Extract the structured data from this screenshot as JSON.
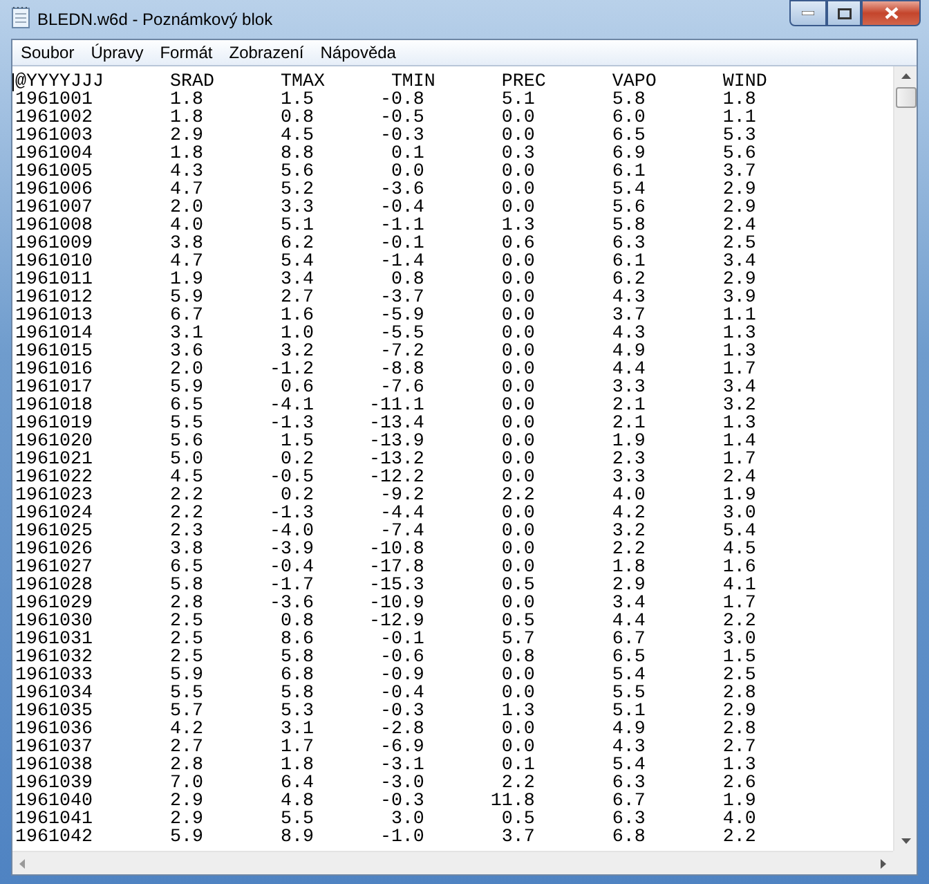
{
  "window": {
    "title": "BLEDN.w6d - Poznámkový blok"
  },
  "menu": [
    "Soubor",
    "Úpravy",
    "Formát",
    "Zobrazení",
    "Nápověda"
  ],
  "document": {
    "columns": [
      "@YYYYJJJ",
      "SRAD",
      "TMAX",
      "TMIN",
      "PREC",
      "VAPO",
      "WIND"
    ],
    "rows": [
      [
        "1961001",
        "1.8",
        "1.5",
        "-0.8",
        "5.1",
        "5.8",
        "1.8"
      ],
      [
        "1961002",
        "1.8",
        "0.8",
        "-0.5",
        "0.0",
        "6.0",
        "1.1"
      ],
      [
        "1961003",
        "2.9",
        "4.5",
        "-0.3",
        "0.0",
        "6.5",
        "5.3"
      ],
      [
        "1961004",
        "1.8",
        "8.8",
        "0.1",
        "0.3",
        "6.9",
        "5.6"
      ],
      [
        "1961005",
        "4.3",
        "5.6",
        "0.0",
        "0.0",
        "6.1",
        "3.7"
      ],
      [
        "1961006",
        "4.7",
        "5.2",
        "-3.6",
        "0.0",
        "5.4",
        "2.9"
      ],
      [
        "1961007",
        "2.0",
        "3.3",
        "-0.4",
        "0.0",
        "5.6",
        "2.9"
      ],
      [
        "1961008",
        "4.0",
        "5.1",
        "-1.1",
        "1.3",
        "5.8",
        "2.4"
      ],
      [
        "1961009",
        "3.8",
        "6.2",
        "-0.1",
        "0.6",
        "6.3",
        "2.5"
      ],
      [
        "1961010",
        "4.7",
        "5.4",
        "-1.4",
        "0.0",
        "6.1",
        "3.4"
      ],
      [
        "1961011",
        "1.9",
        "3.4",
        "0.8",
        "0.0",
        "6.2",
        "2.9"
      ],
      [
        "1961012",
        "5.9",
        "2.7",
        "-3.7",
        "0.0",
        "4.3",
        "3.9"
      ],
      [
        "1961013",
        "6.7",
        "1.6",
        "-5.9",
        "0.0",
        "3.7",
        "1.1"
      ],
      [
        "1961014",
        "3.1",
        "1.0",
        "-5.5",
        "0.0",
        "4.3",
        "1.3"
      ],
      [
        "1961015",
        "3.6",
        "3.2",
        "-7.2",
        "0.0",
        "4.9",
        "1.3"
      ],
      [
        "1961016",
        "2.0",
        "-1.2",
        "-8.8",
        "0.0",
        "4.4",
        "1.7"
      ],
      [
        "1961017",
        "5.9",
        "0.6",
        "-7.6",
        "0.0",
        "3.3",
        "3.4"
      ],
      [
        "1961018",
        "6.5",
        "-4.1",
        "-11.1",
        "0.0",
        "2.1",
        "3.2"
      ],
      [
        "1961019",
        "5.5",
        "-1.3",
        "-13.4",
        "0.0",
        "2.1",
        "1.3"
      ],
      [
        "1961020",
        "5.6",
        "1.5",
        "-13.9",
        "0.0",
        "1.9",
        "1.4"
      ],
      [
        "1961021",
        "5.0",
        "0.2",
        "-13.2",
        "0.0",
        "2.3",
        "1.7"
      ],
      [
        "1961022",
        "4.5",
        "-0.5",
        "-12.2",
        "0.0",
        "3.3",
        "2.4"
      ],
      [
        "1961023",
        "2.2",
        "0.2",
        "-9.2",
        "2.2",
        "4.0",
        "1.9"
      ],
      [
        "1961024",
        "2.2",
        "-1.3",
        "-4.4",
        "0.0",
        "4.2",
        "3.0"
      ],
      [
        "1961025",
        "2.3",
        "-4.0",
        "-7.4",
        "0.0",
        "3.2",
        "5.4"
      ],
      [
        "1961026",
        "3.8",
        "-3.9",
        "-10.8",
        "0.0",
        "2.2",
        "4.5"
      ],
      [
        "1961027",
        "6.5",
        "-0.4",
        "-17.8",
        "0.0",
        "1.8",
        "1.6"
      ],
      [
        "1961028",
        "5.8",
        "-1.7",
        "-15.3",
        "0.5",
        "2.9",
        "4.1"
      ],
      [
        "1961029",
        "2.8",
        "-3.6",
        "-10.9",
        "0.0",
        "3.4",
        "1.7"
      ],
      [
        "1961030",
        "2.5",
        "0.8",
        "-12.9",
        "0.5",
        "4.4",
        "2.2"
      ],
      [
        "1961031",
        "2.5",
        "8.6",
        "-0.1",
        "5.7",
        "6.7",
        "3.0"
      ],
      [
        "1961032",
        "2.5",
        "5.8",
        "-0.6",
        "0.8",
        "6.5",
        "1.5"
      ],
      [
        "1961033",
        "5.9",
        "6.8",
        "-0.9",
        "0.0",
        "5.4",
        "2.5"
      ],
      [
        "1961034",
        "5.5",
        "5.8",
        "-0.4",
        "0.0",
        "5.5",
        "2.8"
      ],
      [
        "1961035",
        "5.7",
        "5.3",
        "-0.3",
        "1.3",
        "5.1",
        "2.9"
      ],
      [
        "1961036",
        "4.2",
        "3.1",
        "-2.8",
        "0.0",
        "4.9",
        "2.8"
      ],
      [
        "1961037",
        "2.7",
        "1.7",
        "-6.9",
        "0.0",
        "4.3",
        "2.7"
      ],
      [
        "1961038",
        "2.8",
        "1.8",
        "-3.1",
        "0.1",
        "5.4",
        "1.3"
      ],
      [
        "1961039",
        "7.0",
        "6.4",
        "-3.0",
        "2.2",
        "6.3",
        "2.6"
      ],
      [
        "1961040",
        "2.9",
        "4.8",
        "-0.3",
        "11.8",
        "6.7",
        "1.9"
      ],
      [
        "1961041",
        "2.9",
        "5.5",
        "3.0",
        "0.5",
        "6.3",
        "4.0"
      ],
      [
        "1961042",
        "5.9",
        "8.9",
        "-1.0",
        "3.7",
        "6.8",
        "2.2"
      ]
    ]
  }
}
